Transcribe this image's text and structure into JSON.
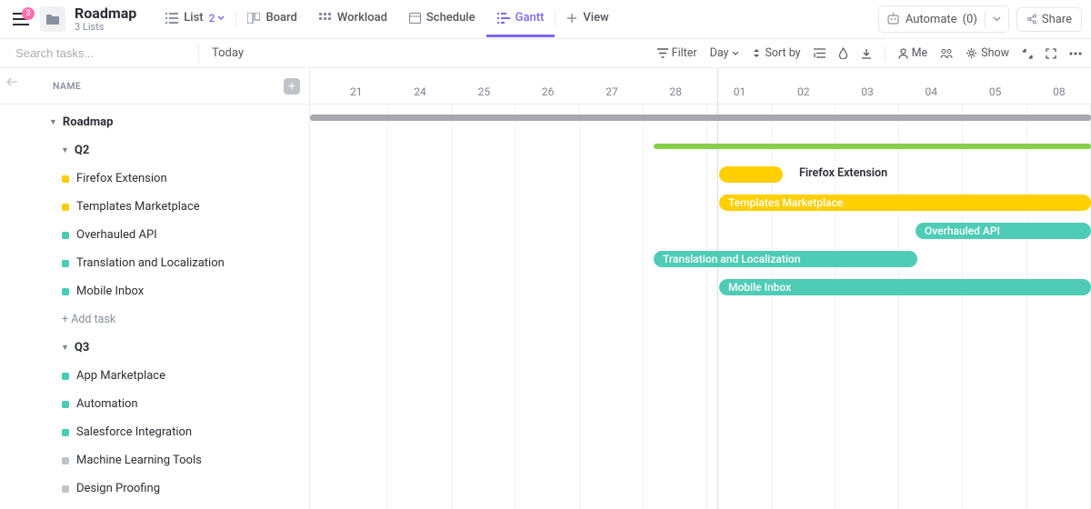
{
  "header": {
    "notification_count": "3",
    "title": "Roadmap",
    "subtitle": "3 Lists",
    "views": [
      {
        "label": "List",
        "count": "2"
      },
      {
        "label": "Board"
      },
      {
        "label": "Workload"
      },
      {
        "label": "Schedule"
      },
      {
        "label": "Gantt",
        "active": true
      },
      {
        "label": "View",
        "add": true
      }
    ],
    "automate_label": "Automate",
    "automate_count": "(0)",
    "share_label": "Share"
  },
  "toolbar": {
    "search_placeholder": "Search tasks...",
    "today_label": "Today",
    "filter_label": "Filter",
    "day_label": "Day",
    "sort_label": "Sort by",
    "me_label": "Me",
    "show_label": "Show"
  },
  "left": {
    "name_header": "NAME",
    "groups": [
      {
        "label": "Roadmap",
        "children": [
          {
            "label": "Q2",
            "tasks": [
              {
                "label": "Firefox Extension",
                "color": "#ffcc00"
              },
              {
                "label": "Templates Marketplace",
                "color": "#ffcc00"
              },
              {
                "label": "Overhauled API",
                "color": "#49ccb4"
              },
              {
                "label": "Translation and Localization",
                "color": "#49ccb4"
              },
              {
                "label": "Mobile Inbox",
                "color": "#49ccb4"
              }
            ],
            "add_task_label": "+ Add task"
          },
          {
            "label": "Q3",
            "tasks": [
              {
                "label": "App Marketplace",
                "color": "#49ccb4"
              },
              {
                "label": "Automation",
                "color": "#49ccb4"
              },
              {
                "label": "Salesforce Integration",
                "color": "#49ccb4"
              },
              {
                "label": "Machine Learning Tools",
                "color": "#bfc3c9"
              },
              {
                "label": "Design Proofing",
                "color": "#bfc3c9"
              }
            ]
          }
        ]
      }
    ]
  },
  "gantt": {
    "dates": [
      "21",
      "24",
      "25",
      "26",
      "27",
      "28",
      "01",
      "02",
      "03",
      "04",
      "05",
      "08"
    ],
    "month_separator_index": 6,
    "bars": {
      "roadmap_start": 0,
      "roadmap_width": 880,
      "q2_start": 378,
      "q2_width": 500,
      "firefox_start": 450,
      "firefox_width": 70,
      "firefox_label": "Firefox Extension",
      "firefox_color": "#ffcf00",
      "templates_start": 450,
      "templates_width": 430,
      "templates_label": "Templates Marketplace",
      "templates_color": "#ffcf00",
      "api_start": 666,
      "api_width": 220,
      "api_label": "Overhauled API",
      "api_color": "#4fccb5",
      "translation_start": 378,
      "translation_width": 290,
      "translation_label": "Translation and Localization",
      "translation_color": "#4fccb5",
      "mobile_start": 450,
      "mobile_width": 430,
      "mobile_label": "Mobile Inbox",
      "mobile_color": "#4fccb5"
    }
  }
}
